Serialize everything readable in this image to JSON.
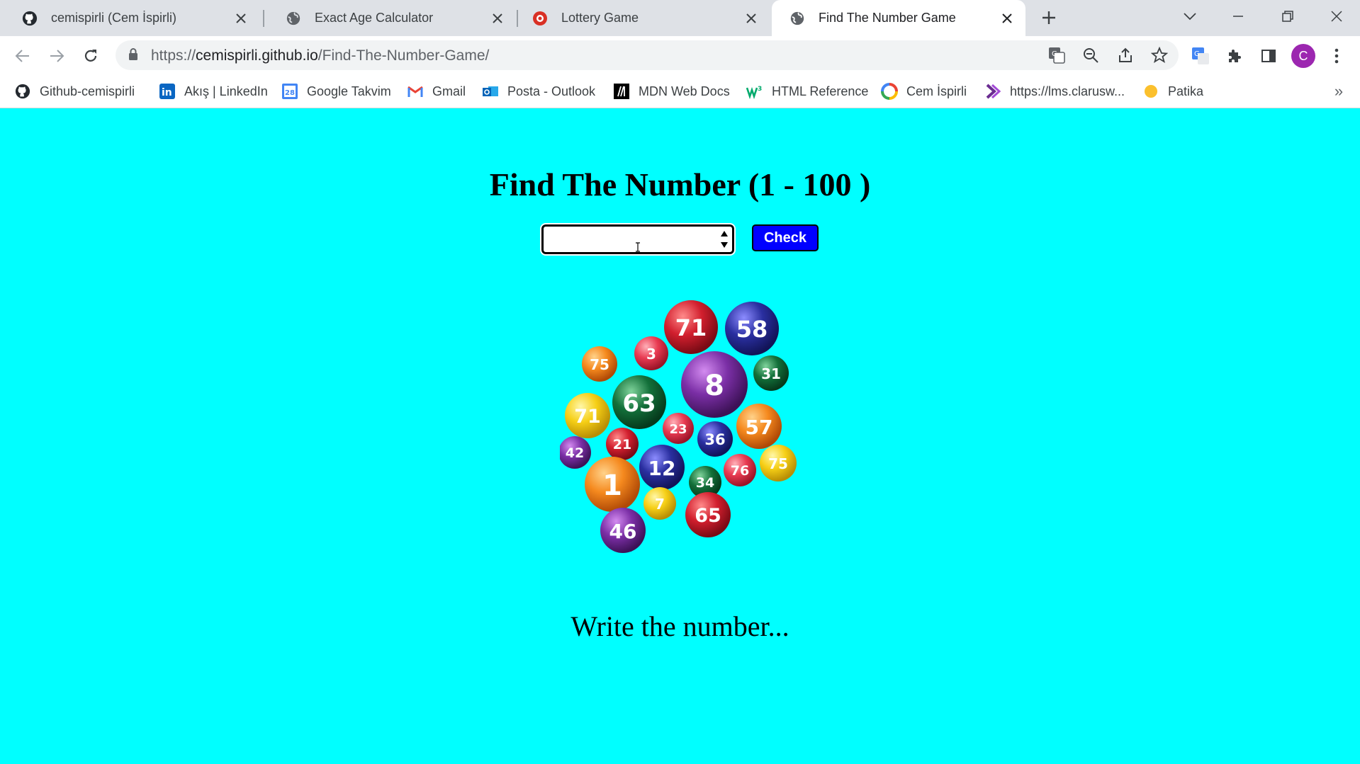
{
  "tabs": [
    {
      "title": "cemispirli (Cem İspirli)",
      "icon": "github-icon"
    },
    {
      "title": "Exact Age Calculator",
      "icon": "globe-icon"
    },
    {
      "title": "Lottery Game",
      "icon": "lottery-icon"
    },
    {
      "title": "Find The Number Game",
      "icon": "globe-icon",
      "active": true
    }
  ],
  "address_bar": {
    "scheme": "https://",
    "host": "cemispirli.github.io",
    "path": "/Find-The-Number-Game/"
  },
  "profile": {
    "initial": "C",
    "color": "#9c27b0"
  },
  "bookmarks": [
    {
      "label": "Github-cemispirli",
      "icon": "github-icon"
    },
    {
      "label": "Akış | LinkedIn",
      "icon": "linkedin-icon"
    },
    {
      "label": "Google Takvim",
      "icon": "calendar-icon"
    },
    {
      "label": "Gmail",
      "icon": "gmail-icon"
    },
    {
      "label": "Posta - Outlook",
      "icon": "outlook-icon"
    },
    {
      "label": "MDN Web Docs",
      "icon": "mdn-icon"
    },
    {
      "label": "HTML Reference",
      "icon": "w3-icon"
    },
    {
      "label": "Cem İspirli",
      "icon": "swirl-icon"
    },
    {
      "label": "https://lms.clarusw...",
      "icon": "clarusway-icon"
    },
    {
      "label": "Patika",
      "icon": "patika-icon"
    }
  ],
  "game": {
    "heading": "Find The Number (1 - 100 )",
    "input_value": "",
    "check_label": "Check",
    "hint": "Write the number...",
    "lottery_balls": [
      "71",
      "58",
      "3",
      "75",
      "8",
      "31",
      "63",
      "71",
      "23",
      "36",
      "57",
      "42",
      "21",
      "76",
      "75",
      "12",
      "34",
      "1",
      "7",
      "65",
      "46"
    ]
  },
  "colors": {
    "page_background": "#00ffff",
    "check_button": "#0000ff"
  }
}
